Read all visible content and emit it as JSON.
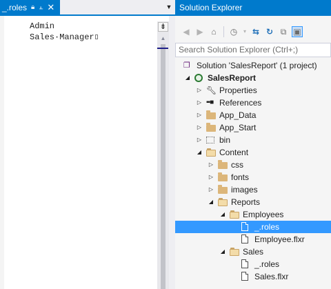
{
  "editor": {
    "tab_label": "_.roles",
    "pin_icon": "pin-icon",
    "lines": [
      "Admin",
      "Sales·Manager"
    ],
    "split_button": "⇟"
  },
  "solution_explorer": {
    "title": "Solution Explorer",
    "search_placeholder": "Search Solution Explorer (Ctrl+;)",
    "toolbar": [
      "back-icon",
      "forward-icon",
      "home-icon",
      "history-icon",
      "sync-icon",
      "refresh-icon",
      "collapse-icon",
      "show-all-files-icon"
    ],
    "tree": [
      {
        "label": "Solution 'SalesReport' (1 project)",
        "type": "solution",
        "depth": 0
      },
      {
        "label": "SalesReport",
        "type": "project",
        "depth": 0,
        "expanded": true
      },
      {
        "label": "Properties",
        "type": "properties",
        "depth": 1,
        "expanded": false
      },
      {
        "label": "References",
        "type": "references",
        "depth": 1,
        "expanded": false
      },
      {
        "label": "App_Data",
        "type": "folder",
        "depth": 1,
        "expanded": false
      },
      {
        "label": "App_Start",
        "type": "folder",
        "depth": 1,
        "expanded": false
      },
      {
        "label": "bin",
        "type": "hidden-folder",
        "depth": 1,
        "expanded": false
      },
      {
        "label": "Content",
        "type": "folder-open",
        "depth": 1,
        "expanded": true
      },
      {
        "label": "css",
        "type": "folder",
        "depth": 2,
        "expanded": false
      },
      {
        "label": "fonts",
        "type": "folder",
        "depth": 2,
        "expanded": false
      },
      {
        "label": "images",
        "type": "folder",
        "depth": 2,
        "expanded": false
      },
      {
        "label": "Reports",
        "type": "folder-open",
        "depth": 2,
        "expanded": true
      },
      {
        "label": "Employees",
        "type": "folder-open",
        "depth": 3,
        "expanded": true
      },
      {
        "label": "_.roles",
        "type": "file",
        "depth": 4,
        "selected": true
      },
      {
        "label": "Employee.flxr",
        "type": "file",
        "depth": 4
      },
      {
        "label": "Sales",
        "type": "folder-open",
        "depth": 3,
        "expanded": true
      },
      {
        "label": "_.roles",
        "type": "file",
        "depth": 4
      },
      {
        "label": "Sales.flxr",
        "type": "file",
        "depth": 4
      }
    ]
  },
  "colors": {
    "accent": "#007acc",
    "selection": "#3399ff",
    "folder": "#dcb67a"
  }
}
